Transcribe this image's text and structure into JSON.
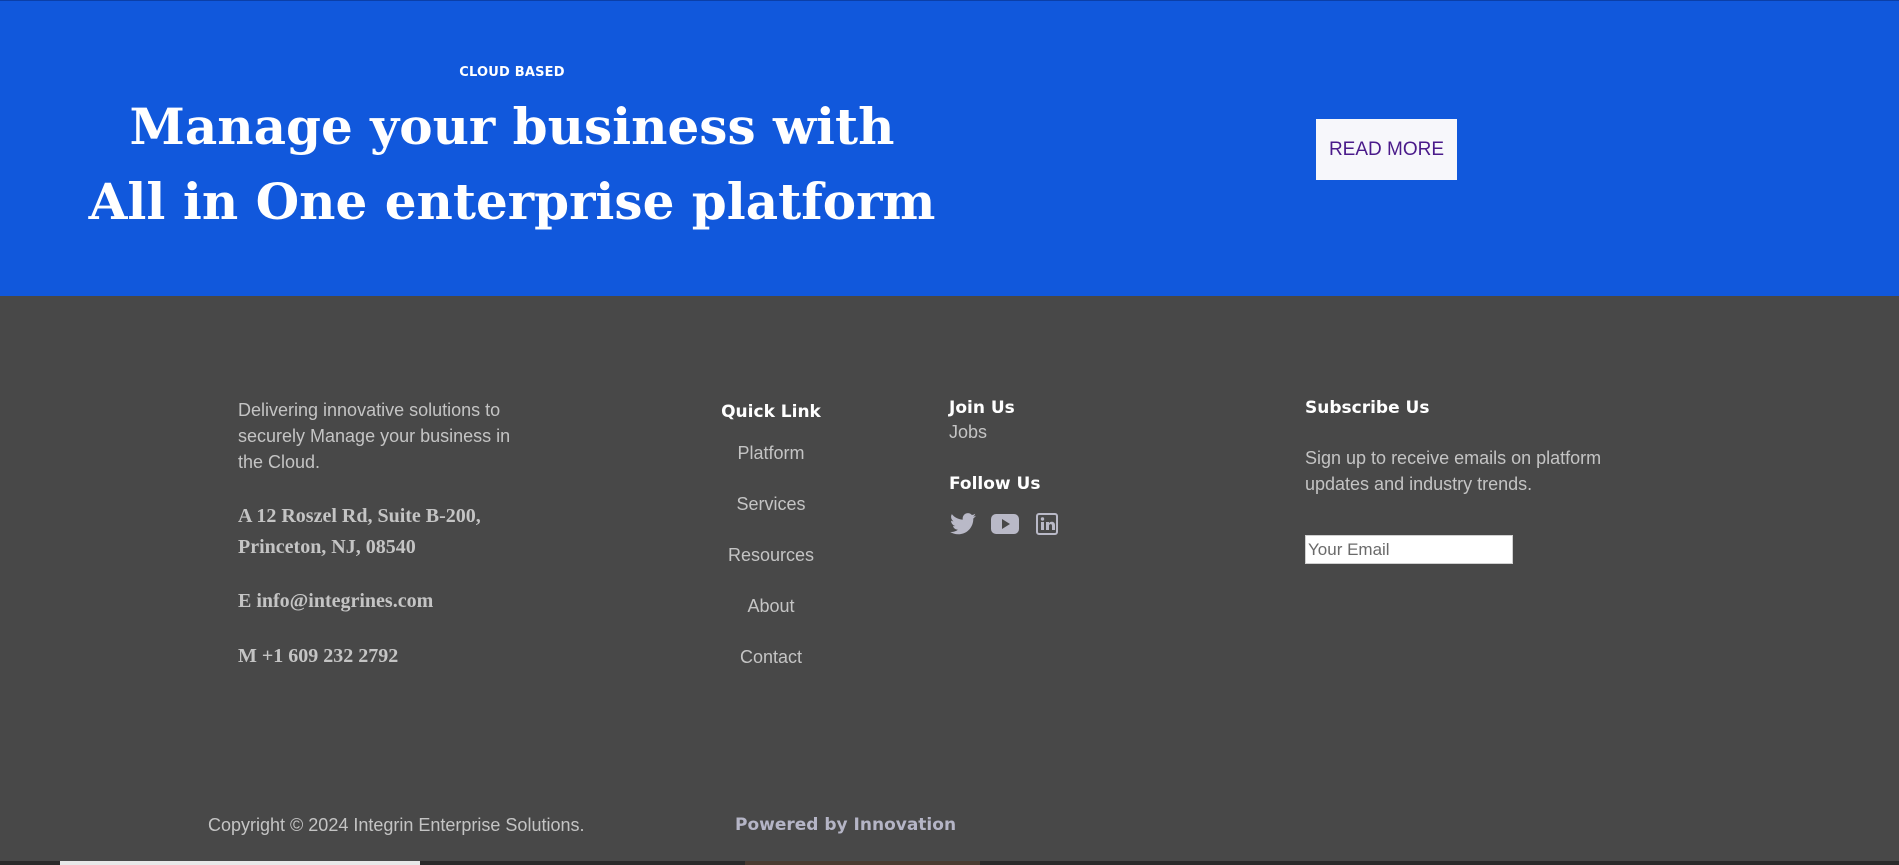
{
  "hero": {
    "eyebrow": "CLOUD BASED",
    "title_line1": "Manage your business with",
    "title_line2": "All in One enterprise platform",
    "cta_label": "READ MORE",
    "bg_color": "#1158dc"
  },
  "footer": {
    "about": {
      "description": "Delivering innovative solutions to securely Manage your business in the Cloud.",
      "address": "A 12 Roszel Rd, Suite B-200, Princeton, NJ, 08540",
      "email": "E info@integrines.com",
      "phone": "M +1 609 232 2792"
    },
    "quick_links": {
      "heading": "Quick Link",
      "items": [
        "Platform",
        "Services",
        "Resources",
        "About",
        "Contact"
      ]
    },
    "join": {
      "heading": "Join Us",
      "jobs_label": "Jobs"
    },
    "follow": {
      "heading": "Follow Us",
      "icons": [
        "twitter-icon",
        "youtube-icon",
        "linkedin-icon"
      ]
    },
    "subscribe": {
      "heading": "Subscribe Us",
      "text": "Sign up to receive emails on platform updates and industry trends.",
      "email_placeholder": "Your Email"
    },
    "copyright": "Copyright © 2024 Integrin Enterprise Solutions.",
    "powered_by": "Powered by Innovation",
    "bg_color": "#484848"
  }
}
